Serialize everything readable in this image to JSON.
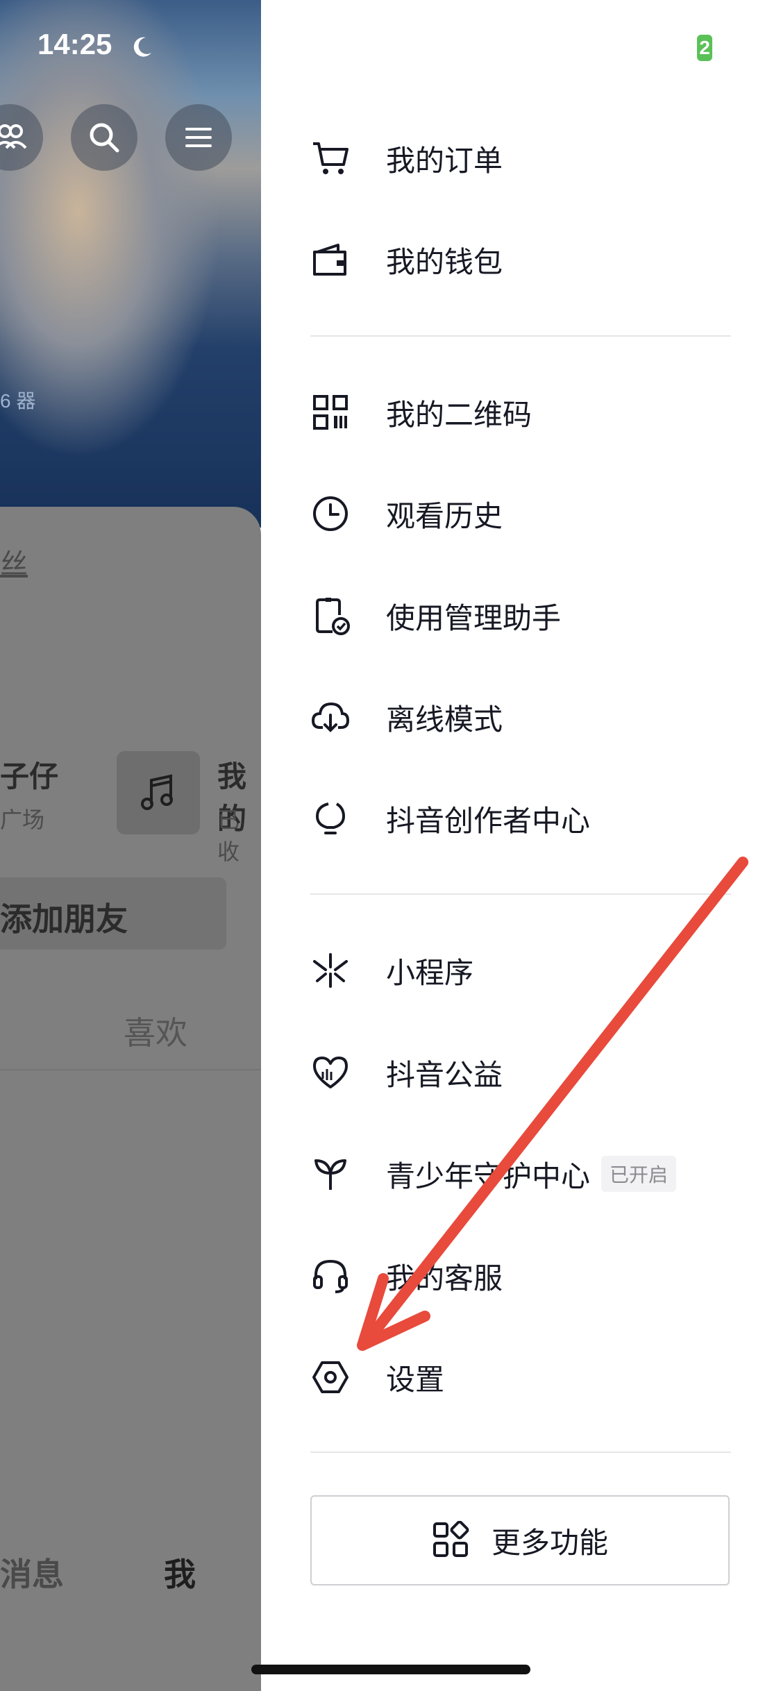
{
  "status_bar": {
    "time": "14:25",
    "battery": "2"
  },
  "background": {
    "fans_fragment": "丝",
    "friend_name_fragment": "子仔",
    "friend_sub_fragment": "广场",
    "music_title_fragment": "我的",
    "music_sub_fragment": "已收",
    "add_friend_fragment": "添加朋友",
    "likes_tab": "喜欢",
    "nav_messages_fragment": "消息",
    "nav_me": "我",
    "qr_fragment": "6 器"
  },
  "drawer": {
    "group1": [
      {
        "label": "我的订单",
        "icon": "cart-icon"
      },
      {
        "label": "我的钱包",
        "icon": "wallet-icon"
      }
    ],
    "group2": [
      {
        "label": "我的二维码",
        "icon": "qr-code-icon"
      },
      {
        "label": "观看历史",
        "icon": "clock-icon"
      },
      {
        "label": "使用管理助手",
        "icon": "phone-check-icon"
      },
      {
        "label": "离线模式",
        "icon": "cloud-download-icon"
      },
      {
        "label": "抖音创作者中心",
        "icon": "lightbulb-icon"
      }
    ],
    "group3": [
      {
        "label": "小程序",
        "icon": "mini-program-icon"
      },
      {
        "label": "抖音公益",
        "icon": "charity-heart-icon"
      },
      {
        "label": "青少年守护中心",
        "icon": "sprout-icon",
        "badge": "已开启"
      },
      {
        "label": "我的客服",
        "icon": "headset-icon"
      },
      {
        "label": "设置",
        "icon": "settings-hexagon-icon"
      }
    ],
    "more_button": {
      "label": "更多功能",
      "icon": "grid-icon"
    }
  },
  "annotation": {
    "arrow_color": "#e84a3c"
  }
}
